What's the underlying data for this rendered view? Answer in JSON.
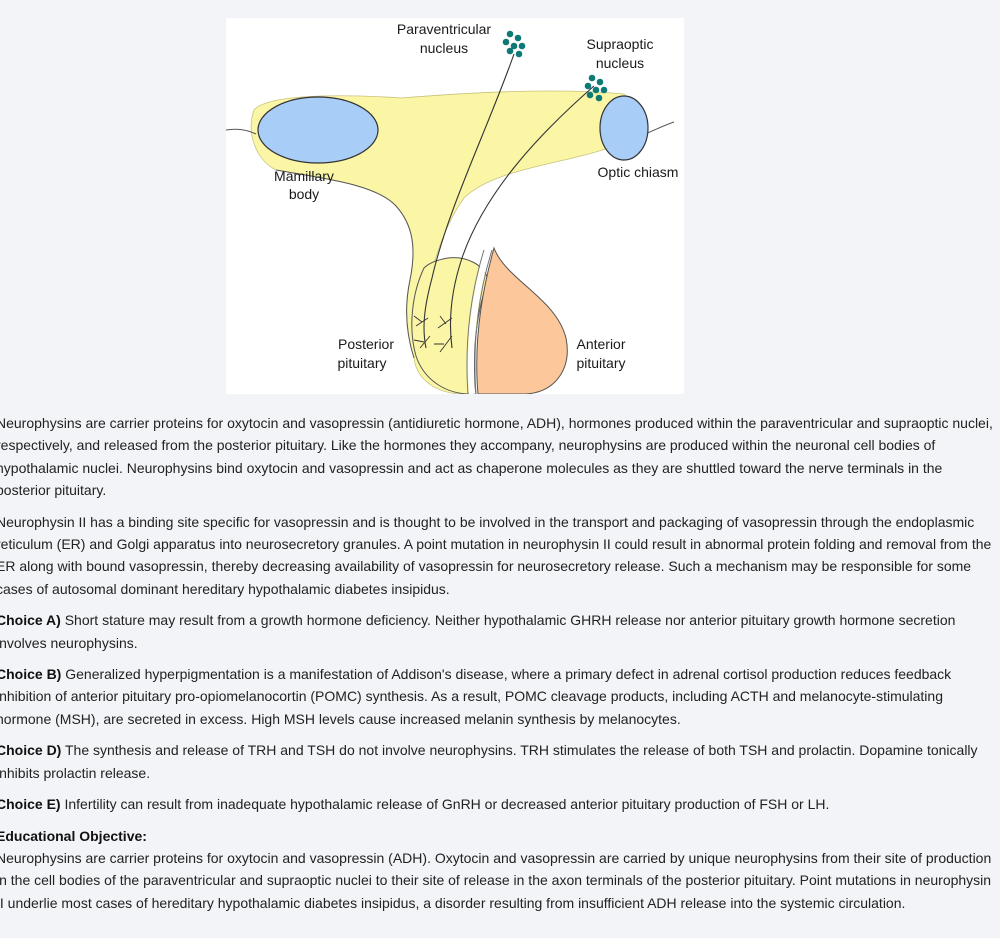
{
  "figure": {
    "labels": {
      "paraventricular_1": "Paraventricular",
      "paraventricular_2": "nucleus",
      "supraoptic_1": "Supraoptic",
      "supraoptic_2": "nucleus",
      "mamillary_1": "Mamillary",
      "mamillary_2": "body",
      "optic_chiasm": "Optic chiasm",
      "posterior_1": "Posterior",
      "posterior_2": "pituitary",
      "anterior_1": "Anterior",
      "anterior_2": "pituitary"
    },
    "colors": {
      "hypothalamus": "#fbf6a6",
      "mamillary": "#a8cdf7",
      "anterior": "#fcc79a",
      "neurons": "#0d7a76"
    }
  },
  "explanation": {
    "p1": "Neurophysins are carrier proteins for oxytocin and vasopressin (antidiuretic hormone, ADH), hormones produced within the paraventricular and supraoptic nuclei, respectively, and released from the posterior pituitary.  Like the hormones they accompany, neurophysins are produced within the neuronal cell bodies of hypothalamic nuclei.  Neurophysins bind oxytocin and vasopressin and act as chaperone molecules as they are shuttled toward the nerve terminals in the posterior pituitary.",
    "p2": "Neurophysin II has a binding site specific for vasopressin and is thought to be involved in the transport and packaging of vasopressin through the endoplasmic reticulum (ER) and Golgi apparatus into neurosecretory granules.  A point mutation in neurophysin II could result in abnormal protein folding and removal from the ER along with bound vasopressin, thereby decreasing availability of vasopressin for neurosecretory release.  Such a mechanism may be responsible for some cases of autosomal dominant hereditary hypothalamic diabetes insipidus.",
    "choices": [
      {
        "label": "Choice A)",
        "text": " Short stature may result from a growth hormone deficiency.  Neither hypothalamic GHRH release nor anterior pituitary growth hormone secretion involves neurophysins."
      },
      {
        "label": "Choice B)",
        "text": " Generalized hyperpigmentation is a manifestation of Addison's disease, where a primary defect in adrenal cortisol production reduces feedback inhibition of anterior pituitary pro-opiomelanocortin (POMC) synthesis.  As a result, POMC cleavage products, including ACTH and melanocyte-stimulating hormone (MSH), are secreted in excess.  High MSH levels cause increased melanin synthesis by melanocytes."
      },
      {
        "label": "Choice D)",
        "text": " The synthesis and release of TRH and TSH do not involve neurophysins.  TRH stimulates the release of both TSH and prolactin.  Dopamine tonically inhibits prolactin release."
      },
      {
        "label": "Choice E)",
        "text": " Infertility can result from inadequate hypothalamic release of GnRH or decreased anterior pituitary production of FSH or LH."
      }
    ],
    "objective_heading": "Educational Objective:",
    "objective_text": "Neurophysins are carrier proteins for oxytocin and vasopressin (ADH).  Oxytocin and vasopressin are carried by unique neurophysins from their site of production in the cell bodies of the paraventricular and supraoptic nuclei to their site of release in the axon terminals of the posterior pituitary.  Point mutations in neurophysin II underlie most cases of hereditary hypothalamic diabetes insipidus, a disorder resulting from insufficient ADH release into the systemic circulation."
  }
}
